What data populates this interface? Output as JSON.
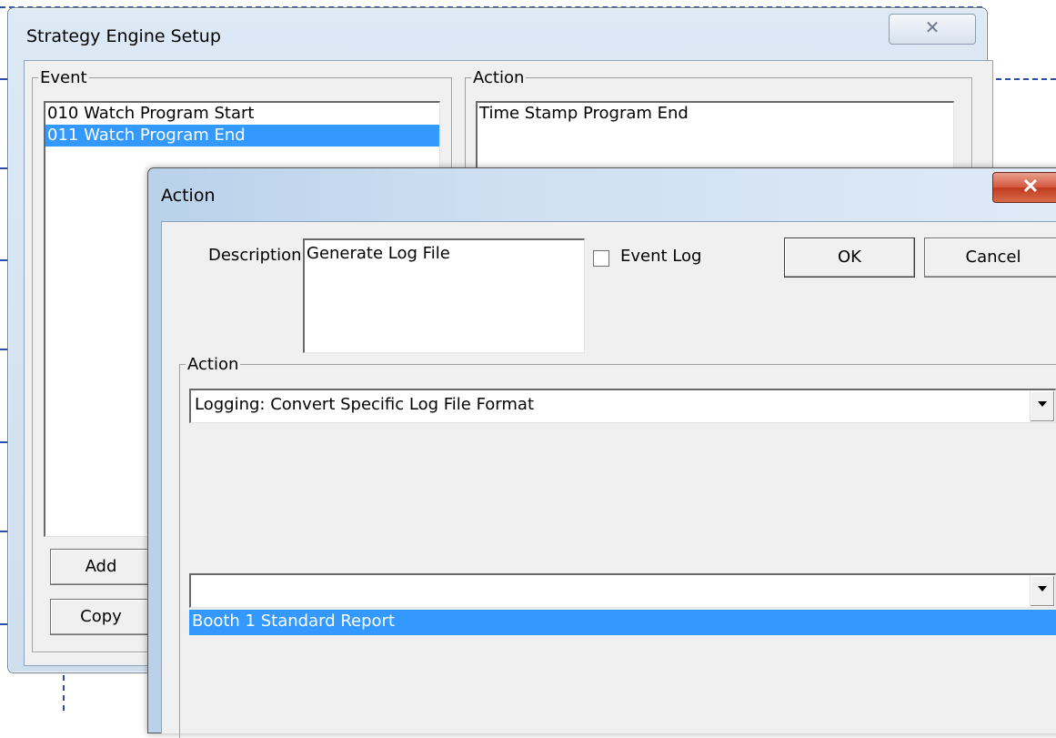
{
  "back_window": {
    "title": "Strategy Engine Setup",
    "close_glyph": "✕",
    "event_group_label": "Event",
    "action_group_label": "Action",
    "events": [
      {
        "label": "010 Watch Program Start",
        "selected": false
      },
      {
        "label": "011 Watch Program End",
        "selected": true
      }
    ],
    "actions": [
      {
        "label": "Time Stamp Program End"
      }
    ],
    "buttons": {
      "add_label": "Add",
      "copy_label": "Copy"
    }
  },
  "action_dialog": {
    "title": "Action",
    "close_glyph": "✕",
    "description_label": "Description",
    "description_value": "Generate Log File",
    "event_log_label": "Event Log",
    "event_log_checked": false,
    "ok_label": "OK",
    "cancel_label": "Cancel",
    "action_group_label": "Action",
    "action_type_value": "Logging: Convert Specific Log File Format",
    "report_select_value": "",
    "report_options": [
      "Booth 1 Standard Report"
    ]
  }
}
